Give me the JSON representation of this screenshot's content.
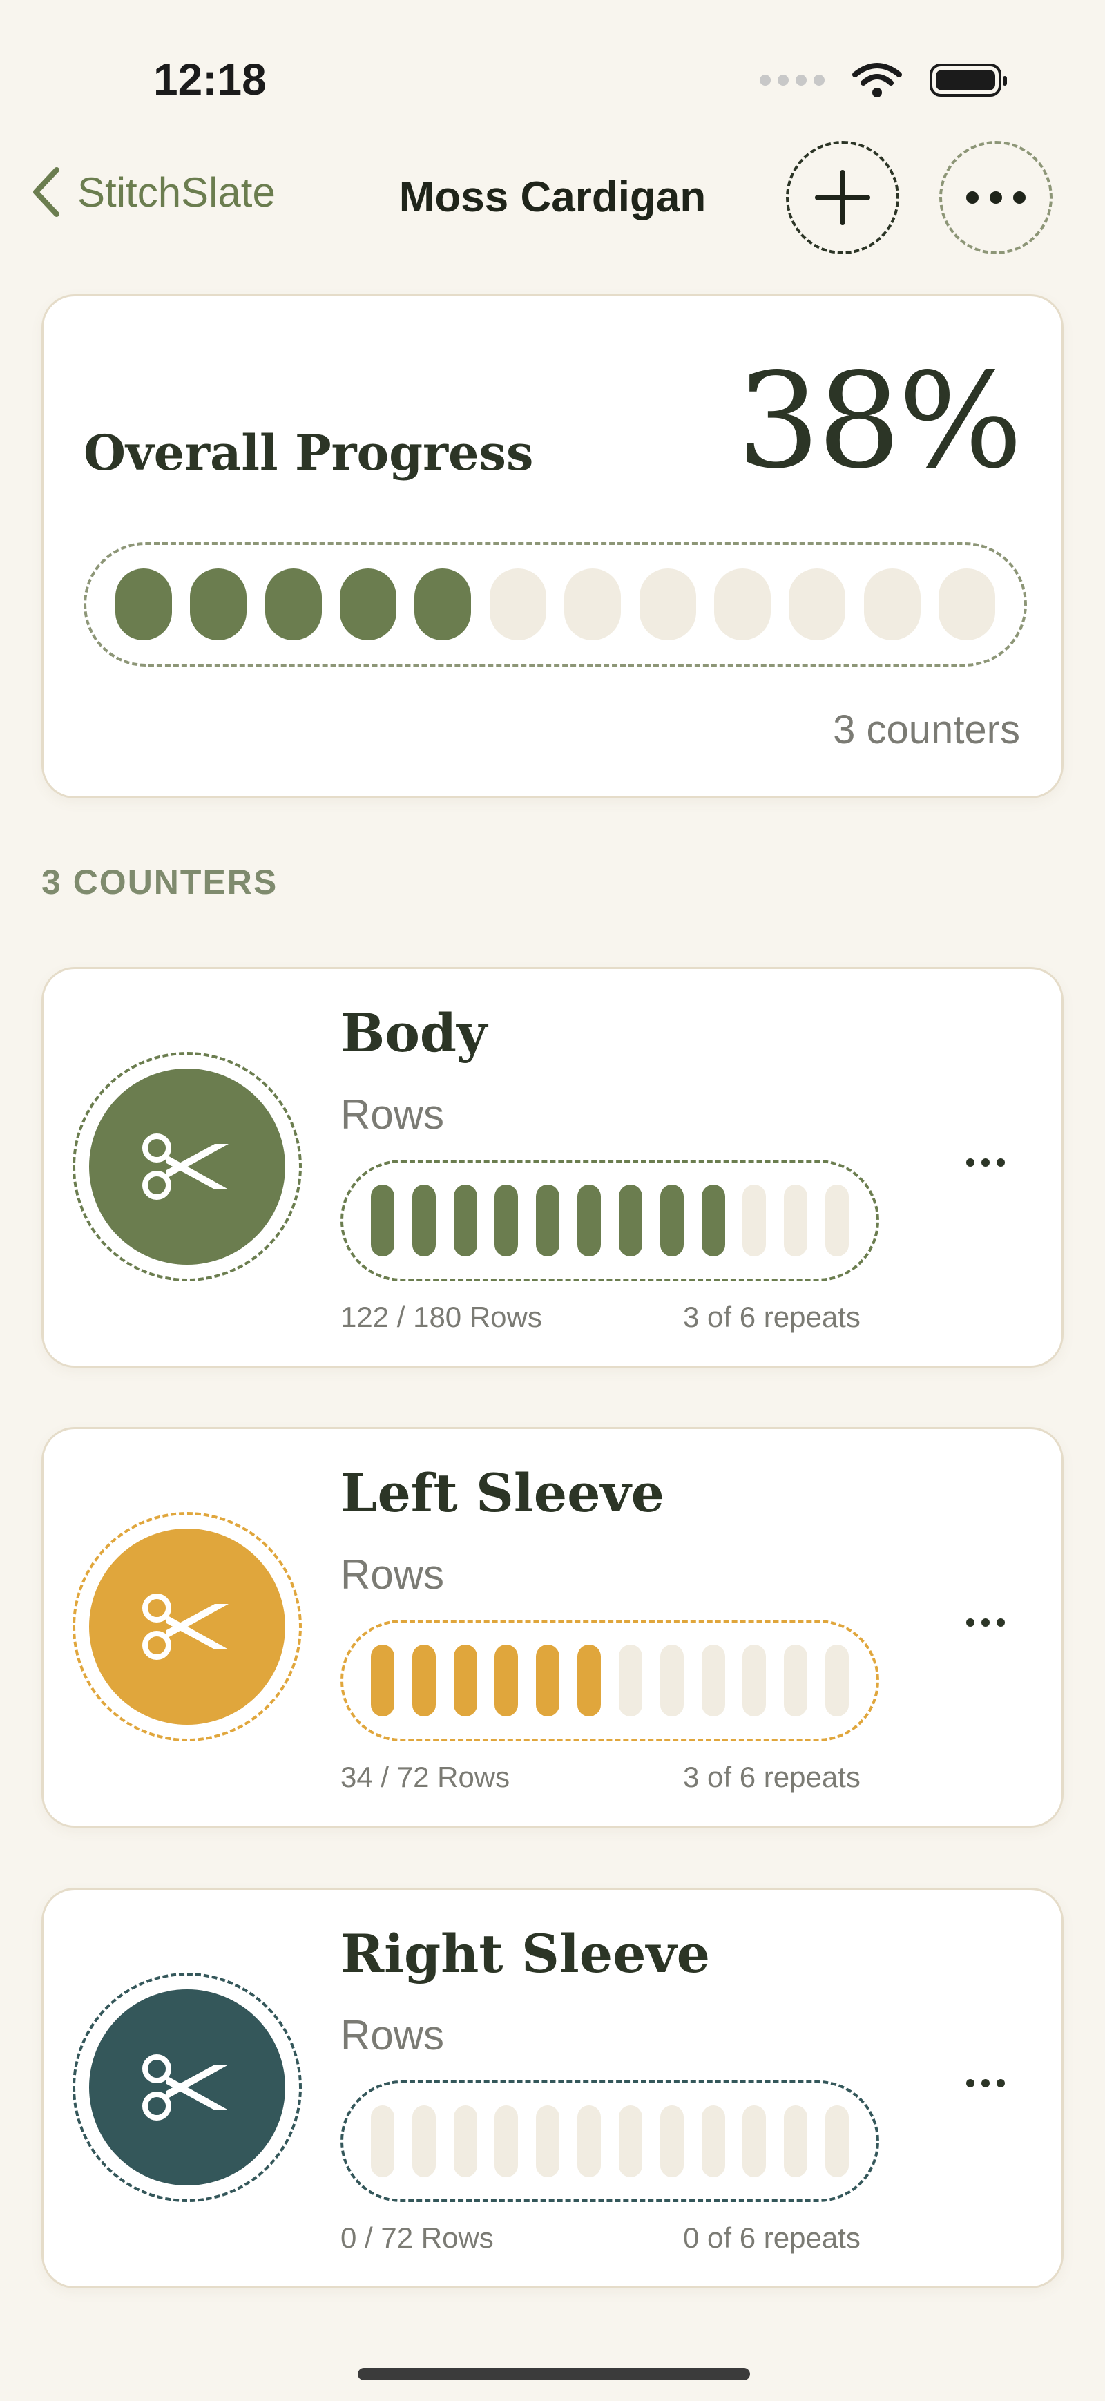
{
  "status": {
    "time": "12:18"
  },
  "nav": {
    "back_label": "StitchSlate",
    "title": "Moss Cardigan"
  },
  "overall": {
    "label": "Overall Progress",
    "percent_text": "38%",
    "progress_fraction": 0.38,
    "segments_total": 12,
    "segments_filled": 5,
    "counter_count_text": "3 counters"
  },
  "section": {
    "label": "3 COUNTERS"
  },
  "counters": [
    {
      "name": "Body",
      "unit": "Rows",
      "rows_text": "122 / 180 Rows",
      "repeats_text": "3 of 6 repeats",
      "current": 122,
      "total": 180,
      "segments_total": 12,
      "segments_filled": 9,
      "color": "#6b7d4f",
      "icon": "scissors-icon"
    },
    {
      "name": "Left Sleeve",
      "unit": "Rows",
      "rows_text": "34 / 72 Rows",
      "repeats_text": "3 of 6 repeats",
      "current": 34,
      "total": 72,
      "segments_total": 12,
      "segments_filled": 6,
      "color": "#e0a63c",
      "icon": "scissors-icon"
    },
    {
      "name": "Right Sleeve",
      "unit": "Rows",
      "rows_text": "0 / 72 Rows",
      "repeats_text": "0 of 6 repeats",
      "current": 0,
      "total": 72,
      "segments_total": 12,
      "segments_filled": 0,
      "color": "#34575a",
      "icon": "scissors-icon"
    }
  ],
  "colors": {
    "background": "#f8f5ee",
    "accent": "#6b7d4f",
    "empty_segment": "#f1ece1",
    "text_dark": "#2c3526",
    "text_muted": "#7b7b74"
  }
}
